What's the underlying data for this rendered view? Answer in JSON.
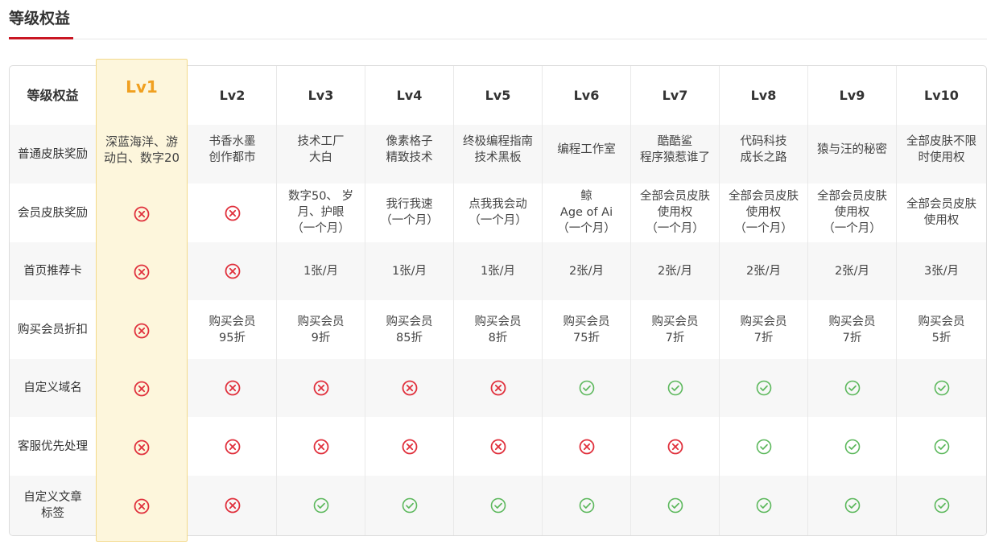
{
  "section": {
    "title": "等级权益"
  },
  "colors": {
    "accent_red": "#c91623",
    "lv1_gold": "#f0a020",
    "check_green": "#5cb85c",
    "cross_red": "#e0303c"
  },
  "table": {
    "corner_label": "等级权益",
    "levels": [
      "Lv1",
      "Lv2",
      "Lv3",
      "Lv4",
      "Lv5",
      "Lv6",
      "Lv7",
      "Lv8",
      "Lv9",
      "Lv10"
    ],
    "rows": [
      {
        "label": "普通皮肤奖励",
        "cells": [
          {
            "text": "深蓝海洋、游\n动白、数字20"
          },
          {
            "text": "书香水墨\n创作都市"
          },
          {
            "text": "技术工厂\n大白"
          },
          {
            "text": "像素格子\n精致技术"
          },
          {
            "text": "终极编程指南\n技术黑板"
          },
          {
            "text": "编程工作室"
          },
          {
            "text": "酷酷鲨\n程序猿惹谁了"
          },
          {
            "text": "代码科技\n成长之路"
          },
          {
            "text": "猿与汪的秘密"
          },
          {
            "text": "全部皮肤不限\n时使用权"
          }
        ]
      },
      {
        "label": "会员皮肤奖励",
        "cells": [
          {
            "icon": "cross"
          },
          {
            "icon": "cross"
          },
          {
            "text": "数字50、 岁\n月、护眼\n（一个月）"
          },
          {
            "text": "我行我速\n（一个月）"
          },
          {
            "text": "点我我会动\n（一个月）"
          },
          {
            "text": "鲸\nAge of Ai\n（一个月）"
          },
          {
            "text": "全部会员皮肤\n使用权\n（一个月）"
          },
          {
            "text": "全部会员皮肤\n使用权\n（一个月）"
          },
          {
            "text": "全部会员皮肤\n使用权\n（一个月）"
          },
          {
            "text": "全部会员皮肤\n使用权"
          }
        ]
      },
      {
        "label": "首页推荐卡",
        "cells": [
          {
            "icon": "cross"
          },
          {
            "icon": "cross"
          },
          {
            "text": "1张/月"
          },
          {
            "text": "1张/月"
          },
          {
            "text": "1张/月"
          },
          {
            "text": "2张/月"
          },
          {
            "text": "2张/月"
          },
          {
            "text": "2张/月"
          },
          {
            "text": "2张/月"
          },
          {
            "text": "3张/月"
          }
        ]
      },
      {
        "label": "购买会员折扣",
        "cells": [
          {
            "icon": "cross"
          },
          {
            "text": "购买会员\n95折"
          },
          {
            "text": "购买会员\n9折"
          },
          {
            "text": "购买会员\n85折"
          },
          {
            "text": "购买会员\n8折"
          },
          {
            "text": "购买会员\n75折"
          },
          {
            "text": "购买会员\n7折"
          },
          {
            "text": "购买会员\n7折"
          },
          {
            "text": "购买会员\n7折"
          },
          {
            "text": "购买会员\n5折"
          }
        ]
      },
      {
        "label": "自定义域名",
        "cells": [
          {
            "icon": "cross"
          },
          {
            "icon": "cross"
          },
          {
            "icon": "cross"
          },
          {
            "icon": "cross"
          },
          {
            "icon": "cross"
          },
          {
            "icon": "check"
          },
          {
            "icon": "check"
          },
          {
            "icon": "check"
          },
          {
            "icon": "check"
          },
          {
            "icon": "check"
          }
        ]
      },
      {
        "label": "客服优先处理",
        "cells": [
          {
            "icon": "cross"
          },
          {
            "icon": "cross"
          },
          {
            "icon": "cross"
          },
          {
            "icon": "cross"
          },
          {
            "icon": "cross"
          },
          {
            "icon": "cross"
          },
          {
            "icon": "cross"
          },
          {
            "icon": "check"
          },
          {
            "icon": "check"
          },
          {
            "icon": "check"
          }
        ]
      },
      {
        "label": "自定义文章\n标签",
        "cells": [
          {
            "icon": "cross"
          },
          {
            "icon": "cross"
          },
          {
            "icon": "check"
          },
          {
            "icon": "check"
          },
          {
            "icon": "check"
          },
          {
            "icon": "check"
          },
          {
            "icon": "check"
          },
          {
            "icon": "check"
          },
          {
            "icon": "check"
          },
          {
            "icon": "check"
          }
        ]
      }
    ]
  }
}
